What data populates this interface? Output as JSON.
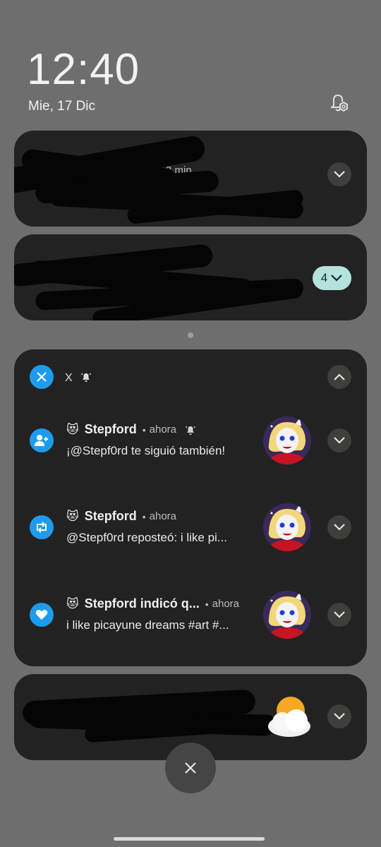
{
  "lockscreen": {
    "time": "12:40",
    "date": "Mie, 17 Dic"
  },
  "card1": {
    "partial_time": "3 min"
  },
  "card2": {
    "group_count": "4"
  },
  "x_group": {
    "app_name": "X",
    "accent_color": "#1d9bf0",
    "notifications": [
      {
        "icon": "follow-icon",
        "emoji": "😻",
        "title": "Stepford",
        "time": "ahora",
        "body": "¡@Stepf0rd te siguió también!"
      },
      {
        "icon": "repost-icon",
        "emoji": "😻",
        "title": "Stepford",
        "time": "ahora",
        "body": "@Stepf0rd reposteó: i like pi..."
      },
      {
        "icon": "heart-icon",
        "emoji": "😻",
        "title": "Stepford indicó q...",
        "time": "ahora",
        "body": "i like picayune dreams #art #..."
      }
    ]
  },
  "weather_card": {
    "icon": "partly-cloudy-icon"
  }
}
